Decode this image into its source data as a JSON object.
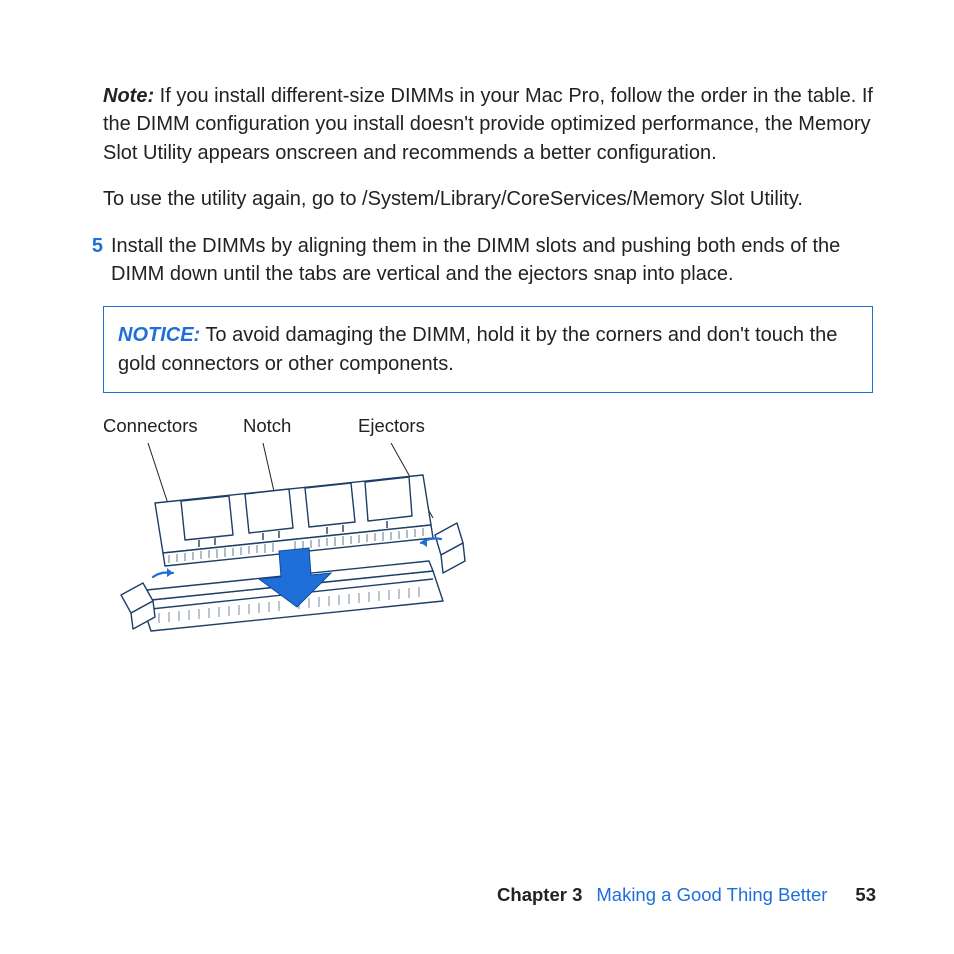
{
  "note": {
    "head": "Note:",
    "body": " If you install different-size DIMMs in your Mac Pro, follow the order in the table. If the DIMM configuration you install doesn't provide optimized performance, the Memory Slot Utility appears onscreen and recommends a better configuration."
  },
  "utility_line": "To use the utility again, go to /System/Library/CoreServices/Memory Slot Utility.",
  "step": {
    "number": "5",
    "text": "Install the DIMMs by aligning them in the DIMM slots and pushing both ends of the DIMM down until the tabs are vertical and the ejectors snap into place."
  },
  "notice": {
    "head": "NOTICE:",
    "body": " To avoid damaging the DIMM, hold it by the corners and don't touch the gold connectors or other components."
  },
  "figure": {
    "labels": {
      "connectors": "Connectors",
      "notch": "Notch",
      "ejectors": "Ejectors"
    }
  },
  "footer": {
    "chapter": "Chapter 3",
    "title": "Making a Good Thing Better",
    "page": "53"
  },
  "colors": {
    "accent": "#1e6fd9",
    "text": "#222222",
    "arrow_fill": "#1e6fd9"
  }
}
